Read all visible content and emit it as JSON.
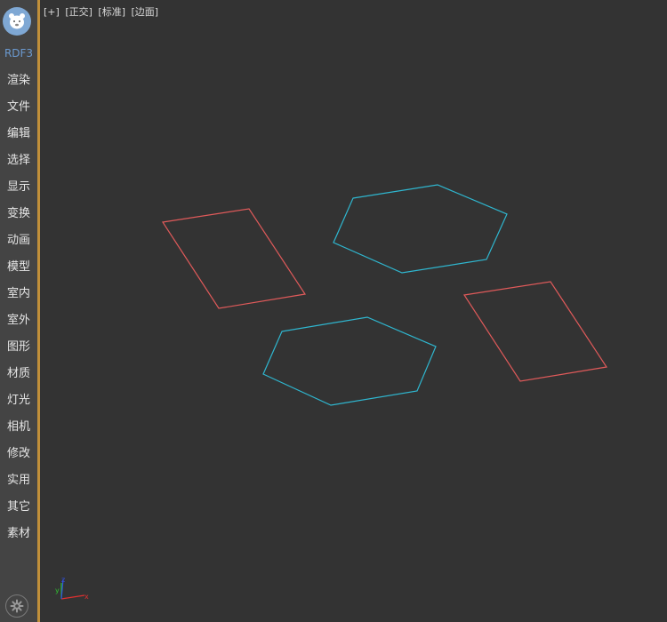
{
  "sidebar": {
    "logo_icon": "bear-face-icon",
    "brand": "RDF3",
    "items": [
      {
        "label": "渲染"
      },
      {
        "label": "文件"
      },
      {
        "label": "编辑"
      },
      {
        "label": "选择"
      },
      {
        "label": "显示"
      },
      {
        "label": "变换"
      },
      {
        "label": "动画"
      },
      {
        "label": "模型"
      },
      {
        "label": "室内"
      },
      {
        "label": "室外"
      },
      {
        "label": "图形"
      },
      {
        "label": "材质"
      },
      {
        "label": "灯光"
      },
      {
        "label": "相机"
      },
      {
        "label": "修改"
      },
      {
        "label": "实用"
      },
      {
        "label": "其它"
      },
      {
        "label": "素材"
      }
    ],
    "settings_icon": "gear-icon"
  },
  "viewport": {
    "labels": {
      "plus": "[+]",
      "projection": "[正交]",
      "shading": "[标准]",
      "mode": "[边面]"
    },
    "axis": {
      "x": "x",
      "y": "y",
      "z": "z"
    },
    "colors": {
      "background": "#333333",
      "rectangle": "#e05a5a",
      "hexagon": "#2fb7d0",
      "axis_x": "#e03030",
      "axis_y": "#30c030",
      "axis_z": "#3050e0"
    },
    "shapes": [
      "rectangle",
      "hexagon",
      "rectangle",
      "hexagon"
    ]
  }
}
